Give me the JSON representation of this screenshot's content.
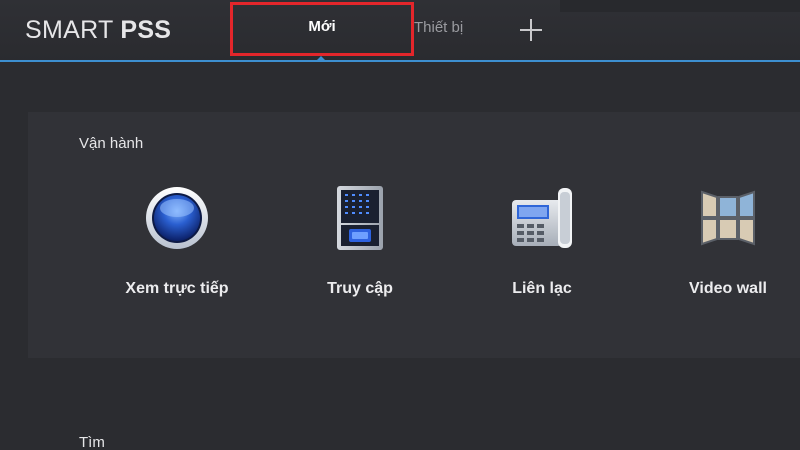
{
  "header": {
    "brand_light": "SMART ",
    "brand_bold": "PSS",
    "tabs": [
      {
        "label": "Mới",
        "active": true
      },
      {
        "label": "Thiết bị",
        "active": false
      }
    ],
    "add_tab_icon": "plus-icon",
    "accent_color": "#3d8fd0",
    "highlight_color": "#e3262b"
  },
  "sections": [
    {
      "title": "Vận hành",
      "items": [
        {
          "label": "Xem trực tiếp",
          "icon": "live-view-icon"
        },
        {
          "label": "Truy cập",
          "icon": "access-control-icon"
        },
        {
          "label": "Liên lạc",
          "icon": "intercom-phone-icon"
        },
        {
          "label": "Video wall",
          "icon": "video-wall-icon"
        }
      ]
    },
    {
      "title": "Tìm",
      "items": []
    }
  ]
}
